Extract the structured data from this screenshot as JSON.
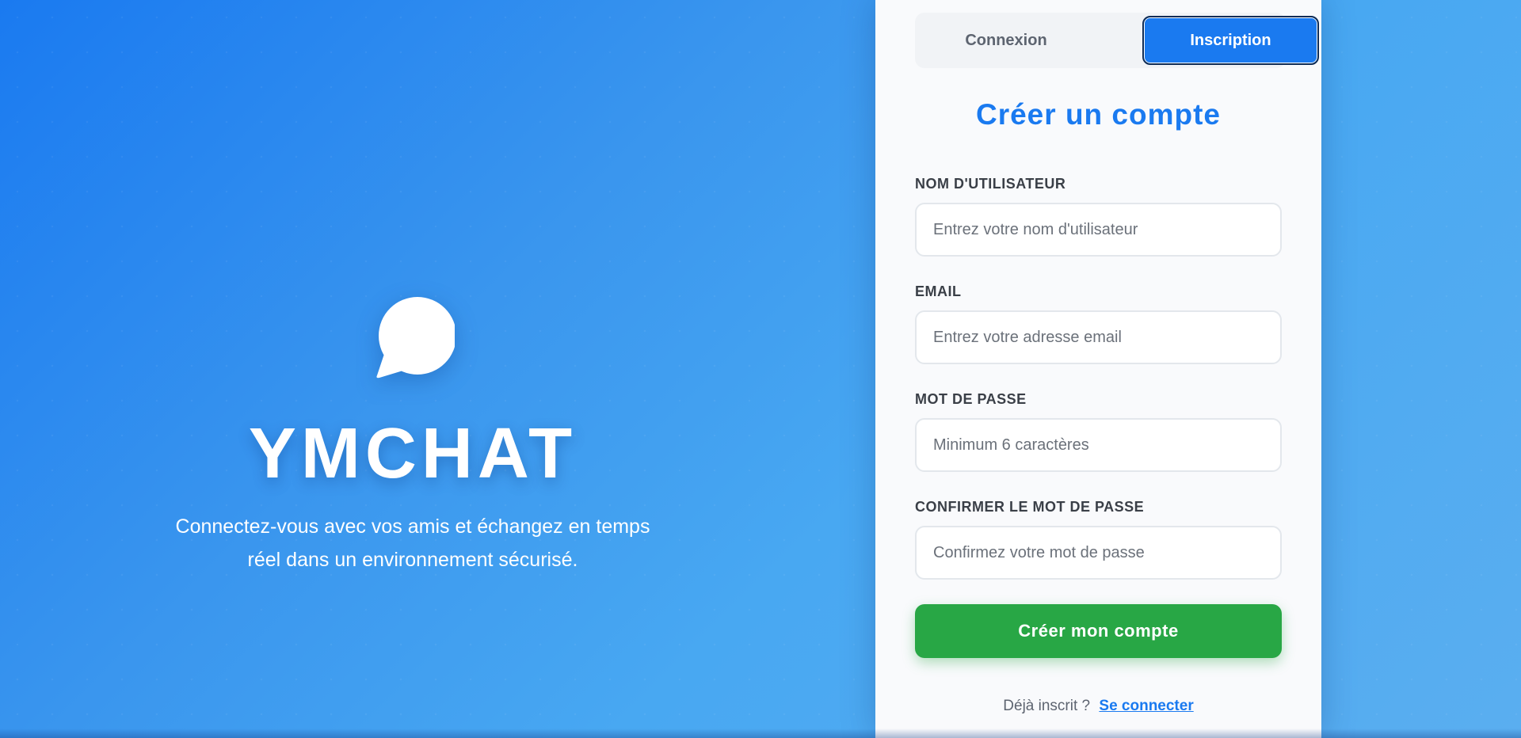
{
  "colors": {
    "primary": "#1a7af0",
    "success": "#28a745",
    "card_bg": "#f9fafc"
  },
  "hero": {
    "logo_icon": "chat-bubble-icon",
    "brand": "YMCHAT",
    "tagline_line1": "Connectez-vous avec vos amis et échangez en temps",
    "tagline_line2": "réel dans un environnement sécurisé."
  },
  "auth": {
    "tabs": {
      "login": "Connexion",
      "register": "Inscription",
      "active": "register"
    },
    "title": "Créer un compte",
    "fields": {
      "username": {
        "label": "NOM D'UTILISATEUR",
        "placeholder": "Entrez votre nom d'utilisateur",
        "value": ""
      },
      "email": {
        "label": "EMAIL",
        "placeholder": "Entrez votre adresse email",
        "value": ""
      },
      "password": {
        "label": "MOT DE PASSE",
        "placeholder": "Minimum 6 caractères",
        "value": ""
      },
      "confirm": {
        "label": "CONFIRMER LE MOT DE PASSE",
        "placeholder": "Confirmez votre mot de passe",
        "value": ""
      }
    },
    "submit_label": "Créer mon compte",
    "footer_text": "Déjà inscrit ?",
    "footer_link": "Se connecter"
  }
}
